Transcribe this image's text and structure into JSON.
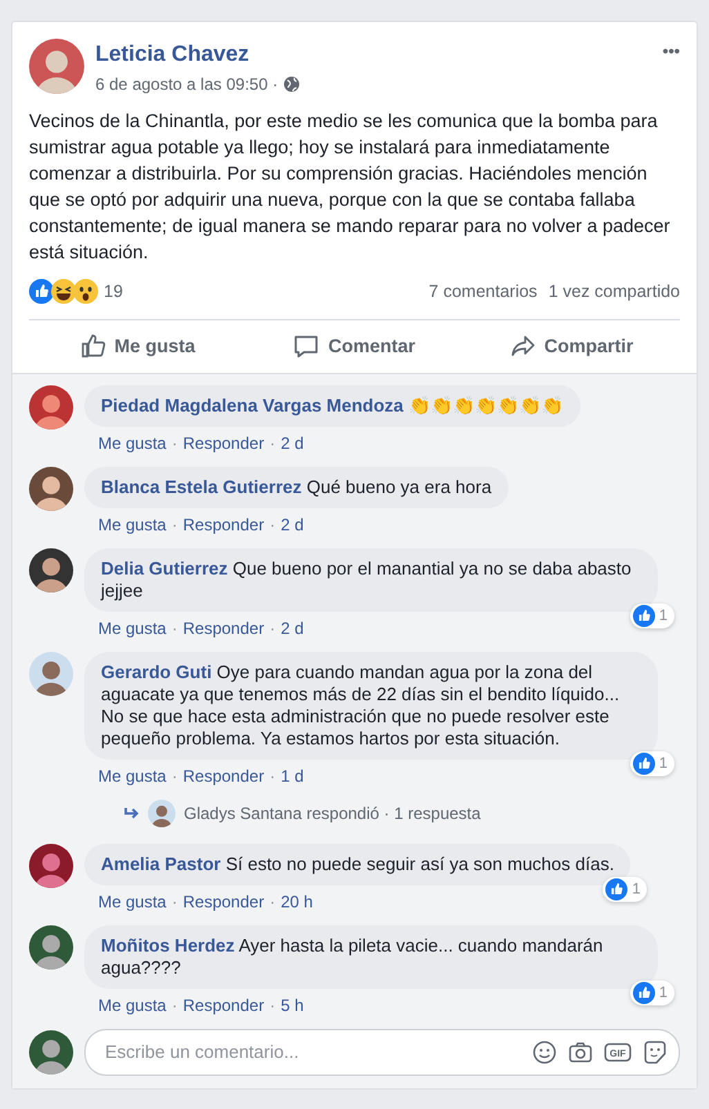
{
  "post": {
    "author": "Leticia Chavez",
    "timestamp": "6 de agosto a las 09:50 ·",
    "menu": "•••",
    "text": "Vecinos de la Chinantla, por este medio se les comunica que la bomba para sumistrar agua potable ya llego; hoy se instalará para inmediatamente comenzar a distribuirla. Por su comprensión gracias. Haciéndoles mención que se optó por adquirir una nueva, porque con la que se contaba fallaba constantemente; de igual manera se mando reparar para no volver a padecer está situación.",
    "reactions": [
      {
        "kind": "like"
      },
      {
        "kind": "haha"
      },
      {
        "kind": "wow"
      }
    ],
    "reaction_count": "19",
    "comments_count": "7 comentarios",
    "shares": "1 vez compartido"
  },
  "actions": [
    {
      "kind": "like",
      "label": "Me gusta"
    },
    {
      "kind": "comment",
      "label": "Comentar"
    },
    {
      "kind": "share",
      "label": "Compartir"
    }
  ],
  "comments": [
    {
      "author": "Piedad Magdalena Vargas Mendoza",
      "text": "👏👏👏👏👏👏👏",
      "like": "Me gusta",
      "separators": [
        "·",
        "·"
      ],
      "reply": "Responder",
      "time": "2 d"
    },
    {
      "author": "Blanca Estela Gutierrez",
      "text": "Qué bueno ya era hora",
      "like": "Me gusta",
      "separators": [
        "·",
        "·"
      ],
      "reply": "Responder",
      "time": "2 d"
    },
    {
      "author": "Delia Gutierrez",
      "text": "Que bueno por el manantial ya no se daba abasto jejjee",
      "like": "Me gusta",
      "separators": [
        "·",
        "·"
      ],
      "reply": "Responder",
      "time": "2 d",
      "likes": "1"
    },
    {
      "author": "Gerardo Guti",
      "text": "Oye para cuando mandan agua por la zona del aguacate ya que tenemos más de 22 días sin el bendito líquido... No se que hace esta administración que no puede resolver este pequeño problema. Ya estamos hartos por esta situación.",
      "like": "Me gusta",
      "separators": [
        "·",
        "·"
      ],
      "reply": "Responder",
      "time": "1 d",
      "likes": "1",
      "replies": "Gladys Santana respondió · 1 respuesta"
    },
    {
      "author": "Amelia Pastor",
      "text": "Sí esto no puede seguir así ya son muchos días.",
      "like": "Me gusta",
      "separators": [
        "·",
        "·"
      ],
      "reply": "Responder",
      "time": "20 h",
      "likes": "1"
    },
    {
      "author": "Moñitos Herdez",
      "text": "Ayer hasta la pileta vacie... cuando mandarán agua????",
      "like": "Me gusta",
      "separators": [
        "·",
        "·"
      ],
      "reply": "Responder",
      "time": "5 h",
      "likes": "1"
    }
  ],
  "composer": {
    "placeholder": "Escribe un comentario...",
    "gif_label": "GIF"
  }
}
